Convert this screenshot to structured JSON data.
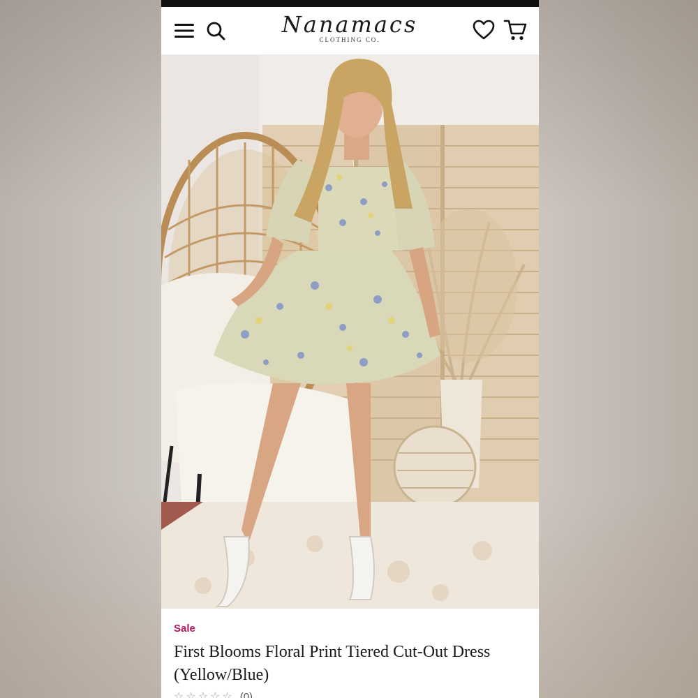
{
  "header": {
    "brand": "Nanamacs",
    "brand_sub": "CLOTHING CO."
  },
  "icons": {
    "menu": "hamburger-menu-icon",
    "search": "search-icon",
    "wishlist": "heart-icon",
    "cart": "cart-icon"
  },
  "gallery": {
    "image_count": 7,
    "active_index": 2
  },
  "product": {
    "badge": "Sale",
    "title": "First Blooms Floral Print Tiered Cut-Out Dress (Yellow/Blue)",
    "rating_stars": "☆☆☆☆☆",
    "review_count": "(0)"
  },
  "colors": {
    "sale": "#b2165b",
    "status_bar": "#111111"
  }
}
